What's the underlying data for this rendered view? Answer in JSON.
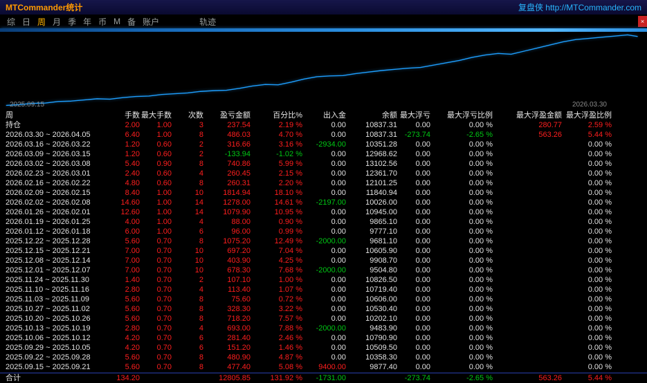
{
  "window": {
    "title": "MTCommander统计",
    "brand": "复盘侠 http://MTCommander.com",
    "close_label": "×"
  },
  "menu": {
    "items": [
      {
        "label": "综",
        "active": false,
        "gap": false
      },
      {
        "label": "日",
        "active": false,
        "gap": false
      },
      {
        "label": "周",
        "active": true,
        "gap": false
      },
      {
        "label": "月",
        "active": false,
        "gap": false
      },
      {
        "label": "季",
        "active": false,
        "gap": false
      },
      {
        "label": "年",
        "active": false,
        "gap": false
      },
      {
        "label": "币",
        "active": false,
        "gap": false
      },
      {
        "label": "M",
        "active": false,
        "gap": false
      },
      {
        "label": "备",
        "active": false,
        "gap": false
      },
      {
        "label": "账户",
        "active": false,
        "gap": false
      },
      {
        "label": "轨迹",
        "active": false,
        "gap": true
      }
    ]
  },
  "chart": {
    "start_label": "2025.09.15",
    "end_label": "2026.03.30",
    "line_color": "#1e9fff",
    "points": [
      [
        1,
        95
      ],
      [
        3,
        94
      ],
      [
        5,
        92.5
      ],
      [
        7,
        92
      ],
      [
        9,
        90
      ],
      [
        11,
        89.5
      ],
      [
        13,
        88
      ],
      [
        15,
        86.5
      ],
      [
        17,
        87
      ],
      [
        19,
        85
      ],
      [
        21,
        83.5
      ],
      [
        23,
        83
      ],
      [
        25,
        81
      ],
      [
        27,
        80
      ],
      [
        29,
        79
      ],
      [
        31,
        77
      ],
      [
        33,
        76
      ],
      [
        35,
        75.5
      ],
      [
        37,
        73
      ],
      [
        39,
        70
      ],
      [
        41,
        68
      ],
      [
        43,
        68.5
      ],
      [
        45,
        65
      ],
      [
        47,
        61
      ],
      [
        49,
        58
      ],
      [
        51,
        57
      ],
      [
        53,
        56.5
      ],
      [
        55,
        54
      ],
      [
        57,
        52
      ],
      [
        59,
        50
      ],
      [
        61,
        48.5
      ],
      [
        63,
        47
      ],
      [
        65,
        46
      ],
      [
        67,
        43
      ],
      [
        69,
        40
      ],
      [
        71,
        37
      ],
      [
        73,
        33
      ],
      [
        75,
        30
      ],
      [
        77,
        28
      ],
      [
        79,
        29
      ],
      [
        81,
        25
      ],
      [
        83,
        21
      ],
      [
        85,
        17
      ],
      [
        87,
        13
      ],
      [
        89,
        10
      ],
      [
        91,
        8.5
      ],
      [
        93,
        7
      ],
      [
        95,
        5.5
      ],
      [
        97,
        4
      ],
      [
        98.5,
        6
      ]
    ]
  },
  "table": {
    "headers": [
      "周",
      "手数",
      "最大手数",
      "次数",
      "盈亏金额",
      "百分比%",
      "出入金",
      "余额",
      "最大浮亏",
      "最大浮亏比例",
      "最大浮盈金额",
      "最大浮盈比例"
    ],
    "rows": [
      {
        "label": "持仓",
        "values": [
          "2.00",
          "1.00",
          "3",
          "237.54",
          "2.19 %",
          "0.00",
          "10837.31",
          "0.00",
          "0.00 %",
          "280.77",
          "2.59 %"
        ],
        "colors": [
          "r",
          "r",
          "r",
          "r",
          "r",
          "w",
          "w",
          "w",
          "w",
          "r",
          "r"
        ]
      },
      {
        "label": "2026.03.30 ~ 2026.04.05",
        "values": [
          "6.40",
          "1.00",
          "8",
          "486.03",
          "4.70 %",
          "0.00",
          "10837.31",
          "-273.74",
          "-2.65 %",
          "563.26",
          "5.44 %"
        ],
        "colors": [
          "r",
          "r",
          "r",
          "r",
          "r",
          "w",
          "w",
          "g",
          "g",
          "r",
          "r"
        ]
      },
      {
        "label": "2026.03.16 ~ 2026.03.22",
        "values": [
          "1.20",
          "0.60",
          "2",
          "316.66",
          "3.16 %",
          "-2934.00",
          "10351.28",
          "0.00",
          "0.00 %",
          "",
          "0.00 %"
        ],
        "colors": [
          "r",
          "r",
          "r",
          "r",
          "r",
          "g",
          "w",
          "w",
          "w",
          "w",
          "w"
        ]
      },
      {
        "label": "2026.03.09 ~ 2026.03.15",
        "values": [
          "1.20",
          "0.60",
          "2",
          "-133.94",
          "-1.02 %",
          "0.00",
          "12968.62",
          "0.00",
          "0.00 %",
          "",
          "0.00 %"
        ],
        "colors": [
          "r",
          "r",
          "r",
          "g",
          "g",
          "w",
          "w",
          "w",
          "w",
          "w",
          "w"
        ]
      },
      {
        "label": "2026.03.02 ~ 2026.03.08",
        "values": [
          "5.40",
          "0.90",
          "8",
          "740.86",
          "5.99 %",
          "0.00",
          "13102.56",
          "0.00",
          "0.00 %",
          "",
          "0.00 %"
        ],
        "colors": [
          "r",
          "r",
          "r",
          "r",
          "r",
          "w",
          "w",
          "w",
          "w",
          "w",
          "w"
        ]
      },
      {
        "label": "2026.02.23 ~ 2026.03.01",
        "values": [
          "2.40",
          "0.60",
          "4",
          "260.45",
          "2.15 %",
          "0.00",
          "12361.70",
          "0.00",
          "0.00 %",
          "",
          "0.00 %"
        ],
        "colors": [
          "r",
          "r",
          "r",
          "r",
          "r",
          "w",
          "w",
          "w",
          "w",
          "w",
          "w"
        ]
      },
      {
        "label": "2026.02.16 ~ 2026.02.22",
        "values": [
          "4.80",
          "0.60",
          "8",
          "260.31",
          "2.20 %",
          "0.00",
          "12101.25",
          "0.00",
          "0.00 %",
          "",
          "0.00 %"
        ],
        "colors": [
          "r",
          "r",
          "r",
          "r",
          "r",
          "w",
          "w",
          "w",
          "w",
          "w",
          "w"
        ]
      },
      {
        "label": "2026.02.09 ~ 2026.02.15",
        "values": [
          "8.40",
          "1.00",
          "10",
          "1814.94",
          "18.10 %",
          "0.00",
          "11840.94",
          "0.00",
          "0.00 %",
          "",
          "0.00 %"
        ],
        "colors": [
          "r",
          "r",
          "r",
          "r",
          "r",
          "w",
          "w",
          "w",
          "w",
          "w",
          "w"
        ]
      },
      {
        "label": "2026.02.02 ~ 2026.02.08",
        "values": [
          "14.60",
          "1.00",
          "14",
          "1278.00",
          "14.61 %",
          "-2197.00",
          "10026.00",
          "0.00",
          "0.00 %",
          "",
          "0.00 %"
        ],
        "colors": [
          "r",
          "r",
          "r",
          "r",
          "r",
          "g",
          "w",
          "w",
          "w",
          "w",
          "w"
        ]
      },
      {
        "label": "2026.01.26 ~ 2026.02.01",
        "values": [
          "12.60",
          "1.00",
          "14",
          "1079.90",
          "10.95 %",
          "0.00",
          "10945.00",
          "0.00",
          "0.00 %",
          "",
          "0.00 %"
        ],
        "colors": [
          "r",
          "r",
          "r",
          "r",
          "r",
          "w",
          "w",
          "w",
          "w",
          "w",
          "w"
        ]
      },
      {
        "label": "2026.01.19 ~ 2026.01.25",
        "values": [
          "4.00",
          "1.00",
          "4",
          "88.00",
          "0.90 %",
          "0.00",
          "9865.10",
          "0.00",
          "0.00 %",
          "",
          "0.00 %"
        ],
        "colors": [
          "r",
          "r",
          "r",
          "r",
          "r",
          "w",
          "w",
          "w",
          "w",
          "w",
          "w"
        ]
      },
      {
        "label": "2026.01.12 ~ 2026.01.18",
        "values": [
          "6.00",
          "1.00",
          "6",
          "96.00",
          "0.99 %",
          "0.00",
          "9777.10",
          "0.00",
          "0.00 %",
          "",
          "0.00 %"
        ],
        "colors": [
          "r",
          "r",
          "r",
          "r",
          "r",
          "w",
          "w",
          "w",
          "w",
          "w",
          "w"
        ]
      },
      {
        "label": "2025.12.22 ~ 2025.12.28",
        "values": [
          "5.60",
          "0.70",
          "8",
          "1075.20",
          "12.49 %",
          "-2000.00",
          "9681.10",
          "0.00",
          "0.00 %",
          "",
          "0.00 %"
        ],
        "colors": [
          "r",
          "r",
          "r",
          "r",
          "r",
          "g",
          "w",
          "w",
          "w",
          "w",
          "w"
        ]
      },
      {
        "label": "2025.12.15 ~ 2025.12.21",
        "values": [
          "7.00",
          "0.70",
          "10",
          "697.20",
          "7.04 %",
          "0.00",
          "10605.90",
          "0.00",
          "0.00 %",
          "",
          "0.00 %"
        ],
        "colors": [
          "r",
          "r",
          "r",
          "r",
          "r",
          "w",
          "w",
          "w",
          "w",
          "w",
          "w"
        ]
      },
      {
        "label": "2025.12.08 ~ 2025.12.14",
        "values": [
          "7.00",
          "0.70",
          "10",
          "403.90",
          "4.25 %",
          "0.00",
          "9908.70",
          "0.00",
          "0.00 %",
          "",
          "0.00 %"
        ],
        "colors": [
          "r",
          "r",
          "r",
          "r",
          "r",
          "w",
          "w",
          "w",
          "w",
          "w",
          "w"
        ]
      },
      {
        "label": "2025.12.01 ~ 2025.12.07",
        "values": [
          "7.00",
          "0.70",
          "10",
          "678.30",
          "7.68 %",
          "-2000.00",
          "9504.80",
          "0.00",
          "0.00 %",
          "",
          "0.00 %"
        ],
        "colors": [
          "r",
          "r",
          "r",
          "r",
          "r",
          "g",
          "w",
          "w",
          "w",
          "w",
          "w"
        ]
      },
      {
        "label": "2025.11.24 ~ 2025.11.30",
        "values": [
          "1.40",
          "0.70",
          "2",
          "107.10",
          "1.00 %",
          "0.00",
          "10826.50",
          "0.00",
          "0.00 %",
          "",
          "0.00 %"
        ],
        "colors": [
          "r",
          "r",
          "r",
          "r",
          "r",
          "w",
          "w",
          "w",
          "w",
          "w",
          "w"
        ]
      },
      {
        "label": "2025.11.10 ~ 2025.11.16",
        "values": [
          "2.80",
          "0.70",
          "4",
          "113.40",
          "1.07 %",
          "0.00",
          "10719.40",
          "0.00",
          "0.00 %",
          "",
          "0.00 %"
        ],
        "colors": [
          "r",
          "r",
          "r",
          "r",
          "r",
          "w",
          "w",
          "w",
          "w",
          "w",
          "w"
        ]
      },
      {
        "label": "2025.11.03 ~ 2025.11.09",
        "values": [
          "5.60",
          "0.70",
          "8",
          "75.60",
          "0.72 %",
          "0.00",
          "10606.00",
          "0.00",
          "0.00 %",
          "",
          "0.00 %"
        ],
        "colors": [
          "r",
          "r",
          "r",
          "r",
          "r",
          "w",
          "w",
          "w",
          "w",
          "w",
          "w"
        ]
      },
      {
        "label": "2025.10.27 ~ 2025.11.02",
        "values": [
          "5.60",
          "0.70",
          "8",
          "328.30",
          "3.22 %",
          "0.00",
          "10530.40",
          "0.00",
          "0.00 %",
          "",
          "0.00 %"
        ],
        "colors": [
          "r",
          "r",
          "r",
          "r",
          "r",
          "w",
          "w",
          "w",
          "w",
          "w",
          "w"
        ]
      },
      {
        "label": "2025.10.20 ~ 2025.10.26",
        "values": [
          "5.60",
          "0.70",
          "8",
          "718.20",
          "7.57 %",
          "0.00",
          "10202.10",
          "0.00",
          "0.00 %",
          "",
          "0.00 %"
        ],
        "colors": [
          "r",
          "r",
          "r",
          "r",
          "r",
          "w",
          "w",
          "w",
          "w",
          "w",
          "w"
        ]
      },
      {
        "label": "2025.10.13 ~ 2025.10.19",
        "values": [
          "2.80",
          "0.70",
          "4",
          "693.00",
          "7.88 %",
          "-2000.00",
          "9483.90",
          "0.00",
          "0.00 %",
          "",
          "0.00 %"
        ],
        "colors": [
          "r",
          "r",
          "r",
          "r",
          "r",
          "g",
          "w",
          "w",
          "w",
          "w",
          "w"
        ]
      },
      {
        "label": "2025.10.06 ~ 2025.10.12",
        "values": [
          "4.20",
          "0.70",
          "6",
          "281.40",
          "2.46 %",
          "0.00",
          "10790.90",
          "0.00",
          "0.00 %",
          "",
          "0.00 %"
        ],
        "colors": [
          "r",
          "r",
          "r",
          "r",
          "r",
          "w",
          "w",
          "w",
          "w",
          "w",
          "w"
        ]
      },
      {
        "label": "2025.09.29 ~ 2025.10.05",
        "values": [
          "4.20",
          "0.70",
          "6",
          "151.20",
          "1.46 %",
          "0.00",
          "10509.50",
          "0.00",
          "0.00 %",
          "",
          "0.00 %"
        ],
        "colors": [
          "r",
          "r",
          "r",
          "r",
          "r",
          "w",
          "w",
          "w",
          "w",
          "w",
          "w"
        ]
      },
      {
        "label": "2025.09.22 ~ 2025.09.28",
        "values": [
          "5.60",
          "0.70",
          "8",
          "480.90",
          "4.87 %",
          "0.00",
          "10358.30",
          "0.00",
          "0.00 %",
          "",
          "0.00 %"
        ],
        "colors": [
          "r",
          "r",
          "r",
          "r",
          "r",
          "w",
          "w",
          "w",
          "w",
          "w",
          "w"
        ]
      },
      {
        "label": "2025.09.15 ~ 2025.09.21",
        "values": [
          "5.60",
          "0.70",
          "8",
          "477.40",
          "5.08 %",
          "9400.00",
          "9877.40",
          "0.00",
          "0.00 %",
          "",
          "0.00 %"
        ],
        "colors": [
          "r",
          "r",
          "r",
          "r",
          "r",
          "r",
          "w",
          "w",
          "w",
          "w",
          "w"
        ]
      }
    ],
    "total": {
      "label": "合计",
      "values": [
        "134.20",
        "",
        "",
        "12805.85",
        "131.92 %",
        "-1731.00",
        "",
        "-273.74",
        "-2.65 %",
        "563.26",
        "5.44 %"
      ],
      "colors": [
        "r",
        "w",
        "w",
        "r",
        "r",
        "g",
        "w",
        "g",
        "g",
        "r",
        "r"
      ]
    }
  },
  "colors": {
    "red": "#ff1e1e",
    "green": "#00c814",
    "white": "#e2e2e2",
    "accent_blue": "#1e9fff",
    "title_orange": "#ff9900",
    "brand_cyan": "#29b6ff",
    "menu_active": "#ffb400"
  }
}
